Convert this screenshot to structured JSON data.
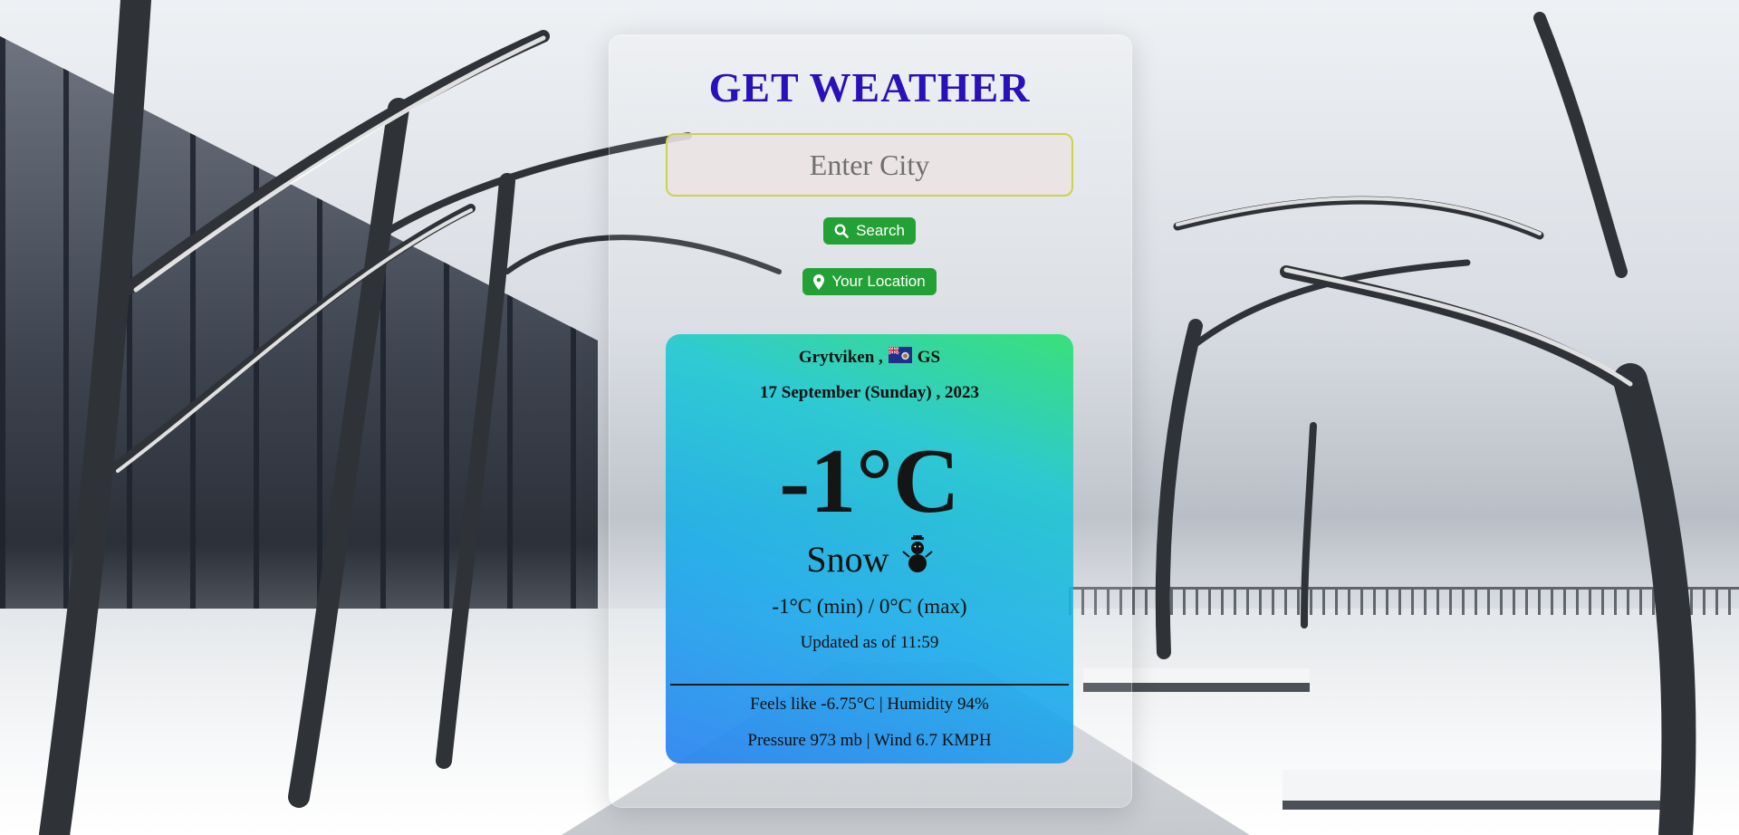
{
  "app": {
    "title": "GET WEATHER"
  },
  "search": {
    "placeholder": "Enter City",
    "value": ""
  },
  "buttons": {
    "search_label": "Search",
    "location_label": "Your Location"
  },
  "weather": {
    "city": "Grytviken ,",
    "country": "GS",
    "date": "17 September (Sunday) , 2023",
    "temperature": "-1°C",
    "condition": "Snow",
    "min_max": "-1°C (min) / 0°C (max)",
    "updated": "Updated as of 11:59",
    "feels_humidity": "Feels like -6.75°C | Humidity 94%",
    "pressure_wind": "Pressure 973 mb | Wind 6.7 KMPH"
  },
  "icons": {
    "search": "search-icon",
    "location": "map-marker-icon",
    "flag": "south-georgia-flag-icon",
    "condition": "snowman-icon"
  },
  "colors": {
    "title": "#2a10b8",
    "button": "#24a136",
    "input_border": "#c9d44a",
    "card_gradient_top": "#2ce070",
    "card_gradient_bottom": "#2882f0"
  }
}
